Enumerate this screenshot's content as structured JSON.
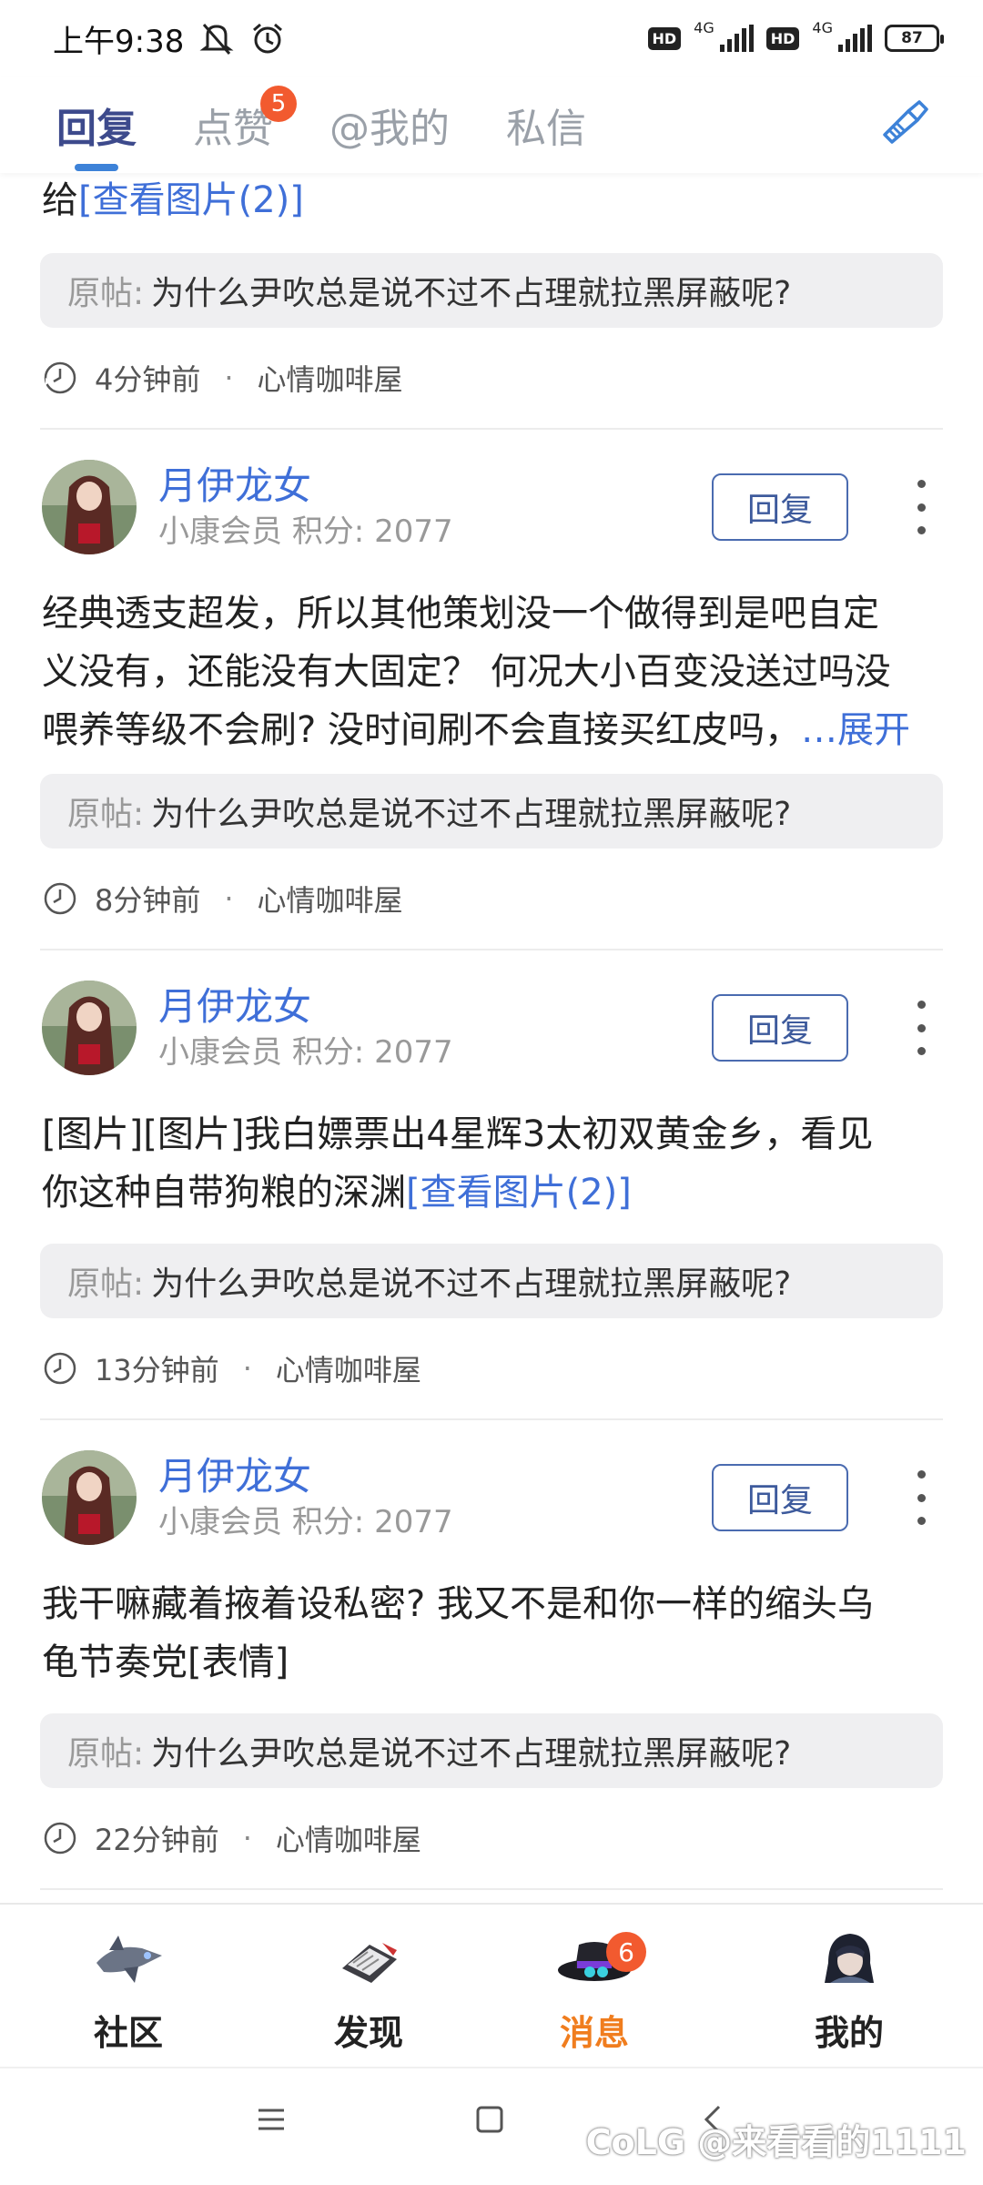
{
  "status": {
    "time": "上午9:38",
    "hd1": "HD",
    "net1": "4G",
    "hd2": "HD",
    "net2": "4G",
    "battery": "87"
  },
  "tabs": [
    {
      "label": "回复",
      "active": true
    },
    {
      "label": "点赞",
      "badge": "5"
    },
    {
      "label": "@我的"
    },
    {
      "label": "私信"
    }
  ],
  "top_fragment": {
    "prefix": "给",
    "link": "[查看图片(2)]",
    "quote_label": "原帖:",
    "quote_text": "为什么尹吹总是说不过不占理就拉黑屏蔽呢?",
    "time": "4分钟前",
    "separator": "·",
    "community": "心情咖啡屋"
  },
  "cards": [
    {
      "username": "月伊龙女",
      "level": "小康会员",
      "score": "积分: 2077",
      "reply_label": "回复",
      "text_lines": [
        "经典透支超发，所以其他策划没一个做得到是吧自定",
        "义没有，还能没有大固定？ 何况大小百变没送过吗没",
        "喂养等级不会刷? 没时间刷不会直接买红皮吗，"
      ],
      "expand": "…展开",
      "quote_label": "原帖:",
      "quote_text": "为什么尹吹总是说不过不占理就拉黑屏蔽呢?",
      "time": "8分钟前",
      "separator": "·",
      "community": "心情咖啡屋"
    },
    {
      "username": "月伊龙女",
      "level": "小康会员",
      "score": "积分: 2077",
      "reply_label": "回复",
      "text_line1": "[图片][图片]我白嫖票出4星辉3太初双黄金乡，看见",
      "text_line2": "你这种自带狗粮的深渊",
      "link": "[查看图片(2)]",
      "quote_label": "原帖:",
      "quote_text": "为什么尹吹总是说不过不占理就拉黑屏蔽呢?",
      "time": "13分钟前",
      "separator": "·",
      "community": "心情咖啡屋"
    },
    {
      "username": "月伊龙女",
      "level": "小康会员",
      "score": "积分: 2077",
      "reply_label": "回复",
      "text_lines": [
        "我干嘛藏着掖着设私密? 我又不是和你一样的缩头乌",
        "龟节奏党[表情]"
      ],
      "quote_label": "原帖:",
      "quote_text": "为什么尹吹总是说不过不占理就拉黑屏蔽呢?",
      "time": "22分钟前",
      "separator": "·",
      "community": "心情咖啡屋"
    }
  ],
  "bottom_nav": [
    {
      "label": "社区",
      "icon": "community-icon"
    },
    {
      "label": "发现",
      "icon": "discover-icon"
    },
    {
      "label": "消息",
      "icon": "message-icon",
      "badge": "6",
      "active": true
    },
    {
      "label": "我的",
      "icon": "profile-icon"
    }
  ],
  "watermark": "CoLG @来看看的1111",
  "colors": {
    "accent": "#3f6fd8",
    "badge": "#f25a2f",
    "active_nav": "#f07d1e",
    "tab_active": "#3d4a8c"
  }
}
